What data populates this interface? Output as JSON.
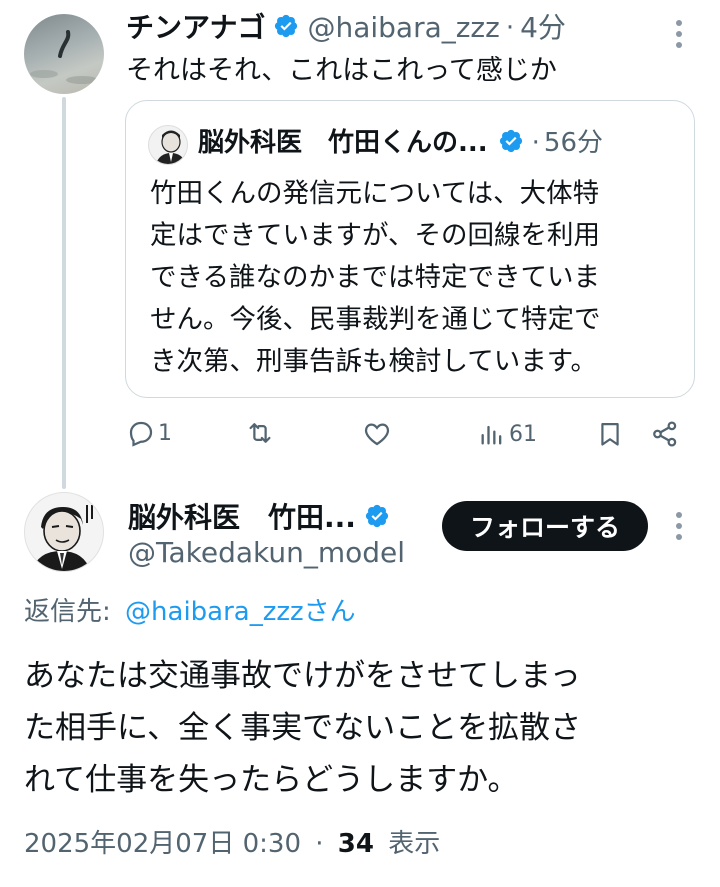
{
  "reply_tweet": {
    "author_name": "チンアナゴ",
    "handle": "@haibara_zzz",
    "time": "4分",
    "text": "それはそれ、これはこれって感じか",
    "quote": {
      "author_name": "脳外科医　竹田くんの...",
      "time": "56分",
      "text_lines": [
        "竹田くんの発信元については、大体特",
        "定はできていますが、その回線を利用",
        "できる誰なのかまでは特定できていま",
        "せん。今後、民事裁判を通じて特定で",
        "き次第、刑事告訴も検討しています。"
      ]
    },
    "actions": {
      "reply_count": "1",
      "retweet_count": "",
      "like_count": "",
      "view_count": "61"
    }
  },
  "main_tweet": {
    "author_name": "脳外科医　竹田...",
    "handle": "@Takedakun_model",
    "follow_label": "フォローする",
    "reply_to_label": "返信先:",
    "reply_to_handle": "@haibara_zzzさん",
    "text_lines": [
      "あなたは交通事故でけがをさせてしまっ",
      "た相手に、全く事実でないことを拡散さ",
      "れて仕事を失ったらどうしますか。"
    ],
    "timestamp": "2025年02月07日 0:30",
    "view_count": "34",
    "view_label": "表示"
  },
  "colors": {
    "verified": "#1d9bf0",
    "link": "#1d9bf0",
    "muted": "#536471",
    "text": "#0f1419"
  },
  "icons": [
    "verified-badge-icon",
    "more-icon",
    "reply-icon",
    "retweet-icon",
    "like-icon",
    "views-icon",
    "bookmark-icon",
    "share-icon"
  ]
}
